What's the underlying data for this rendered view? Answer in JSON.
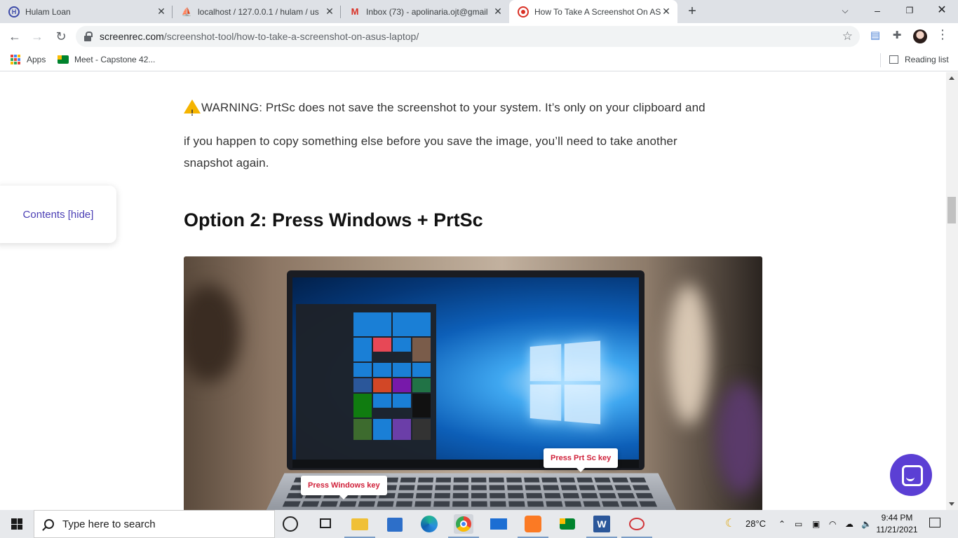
{
  "browser": {
    "tabs": [
      {
        "title": "Hulam Loan",
        "favicon": "H",
        "favicon_color": "#3c4aa8",
        "active": false
      },
      {
        "title": "localhost / 127.0.0.1 / hulam / us",
        "favicon": "phpmyadmin",
        "favicon_color": "#e8a33d",
        "active": false
      },
      {
        "title": "Inbox (73) - apolinaria.ojt@gmail",
        "favicon": "M",
        "favicon_color": "#d93025",
        "active": false
      },
      {
        "title": "How To Take A Screenshot On AS",
        "favicon": "record",
        "favicon_color": "#d93025",
        "active": true
      }
    ],
    "url_domain": "screenrec.com",
    "url_path": "/screenshot-tool/how-to-take-a-screenshot-on-asus-laptop/",
    "bookmarks": [
      {
        "label": "Apps"
      },
      {
        "label": "Meet - Capstone 42..."
      }
    ],
    "reading_list": "Reading list"
  },
  "page": {
    "warning_line1": "WARNING: PrtSc does not save the screenshot to your system. It’s only on your clipboard and",
    "warning_line2": "if you happen to copy something else before you save the image, you’ll need to take another",
    "warning_line3": "snapshot again.",
    "toc_label": "Contents [hide]",
    "heading": "Option 2: Press Windows + PrtSc",
    "callout_prtsc": "Press Prt Sc key",
    "callout_windows": "Press Windows key",
    "accent_color": "#5b3fd4"
  },
  "taskbar": {
    "search_placeholder": "Type here to search",
    "weather": "28°C",
    "time": "9:44 PM",
    "date": "11/21/2021",
    "apps": [
      "task-view",
      "file-explorer",
      "microsoft-store",
      "edge",
      "chrome",
      "mail",
      "xampp",
      "meet",
      "word",
      "snipping-tool"
    ]
  }
}
